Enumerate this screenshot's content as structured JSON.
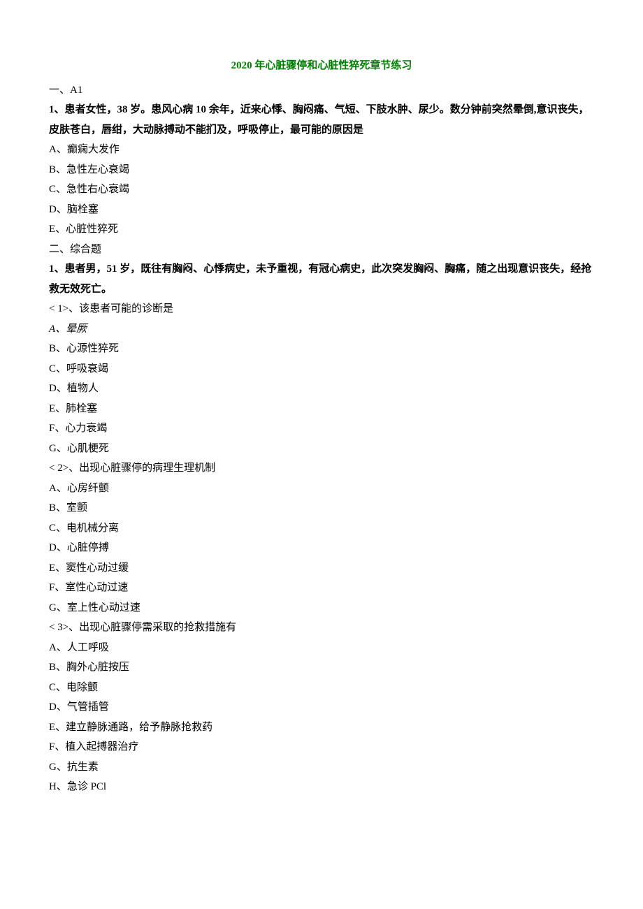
{
  "title": "2020 年心脏骤停和心脏性猝死章节练习",
  "section1": {
    "header": "一、A1",
    "q1": {
      "stem": "1、患者女性，38 岁。患风心病 10 余年，近来心悸、胸闷痛、气短、下肢水肿、尿少。数分钟前突然晕倒,意识丧失，皮肤苍白，唇绀，大动脉搏动不能扪及，呼吸停止，最可能的原因是",
      "opts": {
        "A": "A、癫痫大发作",
        "B": "B、急性左心衰竭",
        "C": "C、急性右心衰竭",
        "D": "D、脑栓塞",
        "E": "E、心脏性猝死"
      }
    }
  },
  "section2": {
    "header": "二、综合题",
    "q1": {
      "stem": "1、患者男，51 岁，既往有胸闷、心悸病史，未予重视，有冠心病史，此次突发胸闷、胸痛，随之出现意识丧失，经抢救无效死亡。",
      "sub1": {
        "prompt": "< 1>、该患者可能的诊断是",
        "opts": {
          "A": "A、晕厥",
          "B": "B、心源性猝死",
          "C": "C、呼吸衰竭",
          "D": "D、植物人",
          "E": "E、肺栓塞",
          "F": "F、心力衰竭",
          "G": "G、心肌梗死"
        }
      },
      "sub2": {
        "prompt": "< 2>、出现心脏骤停的病理生理机制",
        "opts": {
          "A": "A、心房纤颤",
          "B": "B、室颤",
          "C": "C、电机械分离",
          "D": "D、心脏停搏",
          "E": "E、窦性心动过缓",
          "F": "F、室性心动过速",
          "G": "G、室上性心动过速"
        }
      },
      "sub3": {
        "prompt": "< 3>、出现心脏骤停需采取的抢救措施有",
        "opts": {
          "A": "A、人工呼吸",
          "B": "B、胸外心脏按压",
          "C": "C、电除颤",
          "D": "D、气管插管",
          "E": "E、建立静脉通路，给予静脉抢救药",
          "F": "F、植入起搏器治疗",
          "G": "G、抗生素",
          "H": "H、急诊 PCl"
        }
      }
    }
  }
}
